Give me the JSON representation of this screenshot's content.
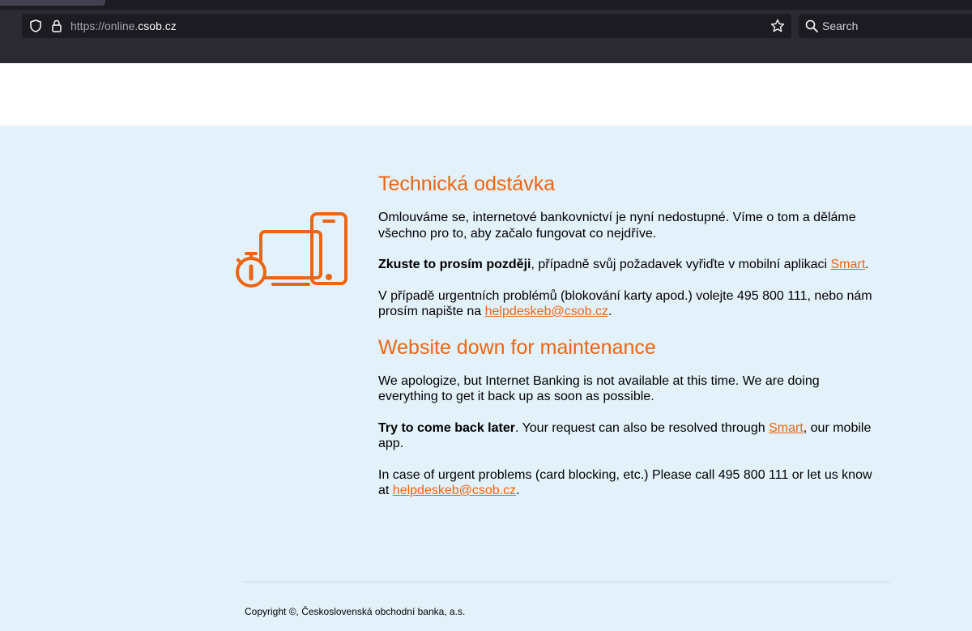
{
  "browser": {
    "url_prefix": "https://online.",
    "url_domain": "csob.cz",
    "search_placeholder": "Search"
  },
  "cz": {
    "title": "Technická odstávka",
    "p1": "Omlouváme se, internetové bankovnictví je nyní nedostupné. Víme o tom a děláme všechno pro to, aby začalo fungovat co nejdříve.",
    "p2_bold": "Zkuste to prosím později",
    "p2_mid": ", případně svůj požadavek vyřiďte v mobilní aplikaci ",
    "p2_link": "Smart",
    "p2_end": ".",
    "p3_text": "V případě urgentních problémů (blokování karty apod.) volejte 495 800 111, nebo nám prosím napište na ",
    "p3_link": "helpdeskeb@csob.cz",
    "p3_end": "."
  },
  "en": {
    "title": "Website down for maintenance",
    "p1": "We apologize, but Internet Banking is not available at this time. We are doing everything to get it back up as soon as possible.",
    "p2_bold": "Try to come back later",
    "p2_mid": ". Your request can also be resolved through ",
    "p2_link": "Smart",
    "p2_end": ", our mobile app.",
    "p3_text": "In case of urgent problems (card blocking, etc.) Please call 495 800 111 or let us know at ",
    "p3_link": "helpdeskeb@csob.cz",
    "p3_end": "."
  },
  "footer": {
    "copyright": "Copyright ©, Československá obchodní banka, a.s."
  },
  "colors": {
    "accent": "#ec6512",
    "page_background": "#e3f1fa"
  },
  "icons": {
    "illustration": "devices-with-stopwatch-icon"
  }
}
